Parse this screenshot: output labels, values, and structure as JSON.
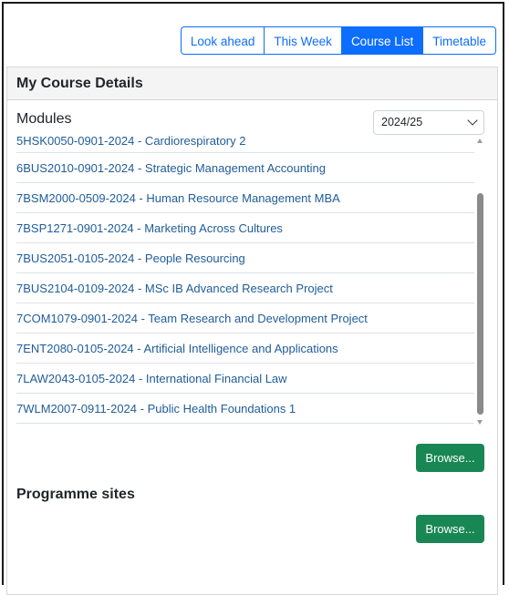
{
  "tabs": [
    {
      "label": "Look ahead",
      "active": false
    },
    {
      "label": "This Week",
      "active": false
    },
    {
      "label": "Course List",
      "active": true
    },
    {
      "label": "Timetable",
      "active": false
    }
  ],
  "card": {
    "title": "My Course Details",
    "modules_heading": "Modules",
    "year_select": {
      "value": "2024/25"
    },
    "modules": [
      "5HSK0050-0901-2024 - Cardiorespiratory 2",
      "6BUS2010-0901-2024 - Strategic Management Accounting",
      "7BSM2000-0509-2024 - Human Resource Management MBA",
      "7BSP1271-0901-2024 - Marketing Across Cultures",
      "7BUS2051-0105-2024 - People Resourcing",
      "7BUS2104-0109-2024 - MSc IB Advanced Research Project",
      "7COM1079-0901-2024 - Team Research and Development Project",
      "7ENT2080-0105-2024 - Artificial Intelligence and Applications",
      "7LAW2043-0105-2024 - International Financial Law",
      "7WLM2007-0911-2024 - Public Health Foundations 1"
    ],
    "modules_browse_label": "Browse...",
    "programme_heading": "Programme sites",
    "programme_browse_label": "Browse..."
  },
  "colors": {
    "primary": "#0d6efd",
    "link": "#1f5c99",
    "success": "#198754"
  }
}
